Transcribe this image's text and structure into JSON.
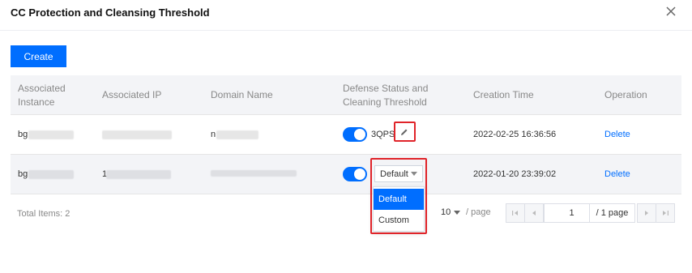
{
  "dialog": {
    "title": "CC Protection and Cleansing Threshold",
    "close_icon": "close-icon"
  },
  "toolbar": {
    "create_label": "Create"
  },
  "table": {
    "headers": {
      "instance_line1": "Associated",
      "instance_line2": "Instance",
      "ip": "Associated IP",
      "domain": "Domain Name",
      "defense_line1": "Defense Status and",
      "defense_line2": "Cleaning Threshold",
      "time": "Creation Time",
      "operation": "Operation"
    },
    "rows": [
      {
        "instance_prefix": "bg",
        "domain_prefix": "n",
        "defense_on": true,
        "threshold": "3QPS",
        "edit_icon": "pencil-icon",
        "time": "2022-02-25 16:36:56",
        "action": "Delete"
      },
      {
        "instance_prefix": "bg",
        "ip_prefix": "1",
        "defense_on": true,
        "threshold_select": "Default",
        "time": "2022-01-20 23:39:02",
        "action": "Delete"
      }
    ]
  },
  "threshold_dropdown": {
    "options": [
      "Default",
      "Custom"
    ],
    "selected": "Default"
  },
  "footer": {
    "total": "Total Items: 2",
    "page_size": "10",
    "page_size_suffix": "/ page",
    "page_input": "1",
    "page_total": "/ 1 page"
  },
  "colors": {
    "accent": "#006eff",
    "highlight_border": "#e0242a",
    "header_bg": "#f3f4f7"
  }
}
